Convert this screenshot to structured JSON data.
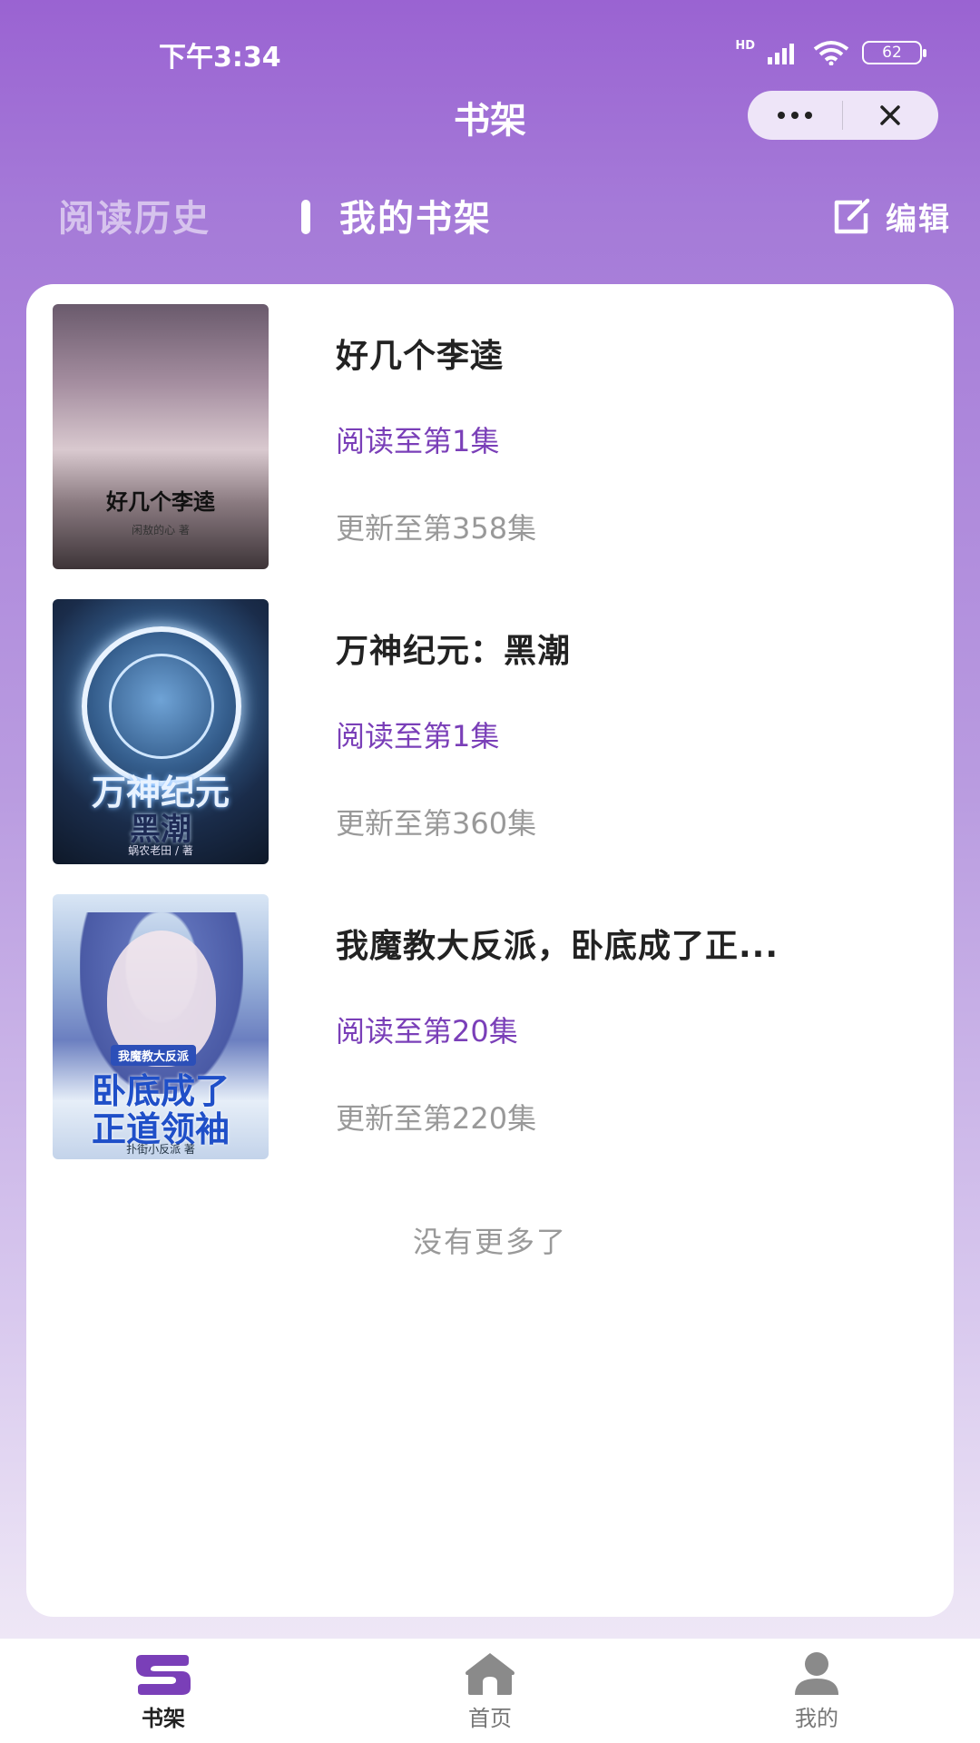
{
  "status_bar": {
    "time": "下午3:34",
    "network": "HD",
    "battery": "62"
  },
  "nav": {
    "title": "书架"
  },
  "tabs": {
    "history": "阅读历史",
    "shelf": "我的书架",
    "edit": "编辑"
  },
  "books": [
    {
      "title": "好几个李逵",
      "progress": "阅读至第1集",
      "update": "更新至第358集",
      "cover_title": "好几个李逵",
      "cover_author": "闲敖的心 著"
    },
    {
      "title": "万神纪元：黑潮",
      "progress": "阅读至第1集",
      "update": "更新至第360集",
      "cover_title": "万神纪元",
      "cover_subtitle": "黑潮",
      "cover_author": "蜗农老田 / 著"
    },
    {
      "title": "我魔教大反派，卧底成了正...",
      "progress": "阅读至第20集",
      "update": "更新至第220集",
      "cover_tag": "我魔教大反派",
      "cover_title": "卧底成了",
      "cover_subtitle": "正道领袖",
      "cover_author": "扑街小反派 著"
    }
  ],
  "footer_text": "没有更多了",
  "tabbar": {
    "items": [
      {
        "label": "书架",
        "icon": "bookshelf-icon",
        "active": true
      },
      {
        "label": "首页",
        "icon": "home-icon",
        "active": false
      },
      {
        "label": "我的",
        "icon": "user-icon",
        "active": false
      }
    ]
  },
  "colors": {
    "accent": "#7a3fb8",
    "header_gradient_top": "#9a63d2",
    "muted_text": "#999999"
  }
}
